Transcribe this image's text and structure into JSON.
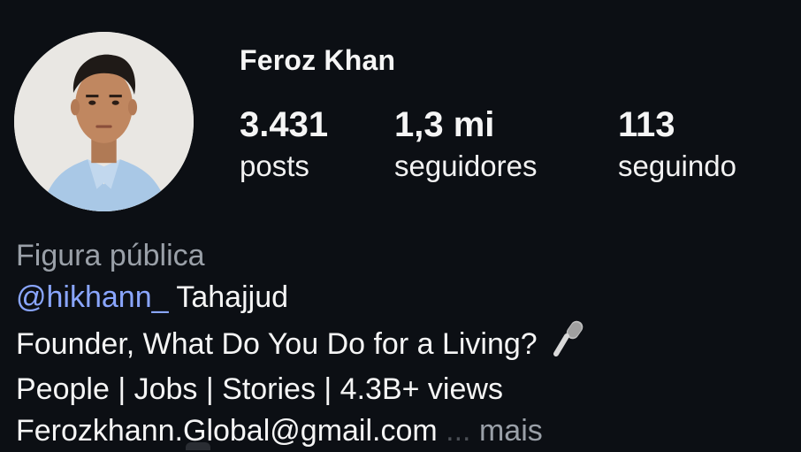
{
  "profile": {
    "username": "Feroz Khan",
    "avatar_icon": "profile-photo",
    "stats": [
      {
        "value": "3.431",
        "label": "posts"
      },
      {
        "value": "1,3 mi",
        "label": "seguidores"
      },
      {
        "value": "113",
        "label": "seguindo"
      }
    ]
  },
  "bio": {
    "category": "Figura pública",
    "mention": "@hikhann_",
    "mention_suffix": " Tahajjud",
    "line2": "Founder, What Do You Do for a Living?",
    "line2_icon": "microphone-icon",
    "line3": "People | Jobs | Stories | 4.3B+ views",
    "email": "Ferozkhann.Global@gmail.com",
    "more_dots": " ...",
    "more_label": "mais"
  },
  "colors": {
    "background": "#0c0f14",
    "mention": "#8aa6ff",
    "muted": "#9aa0a8"
  }
}
